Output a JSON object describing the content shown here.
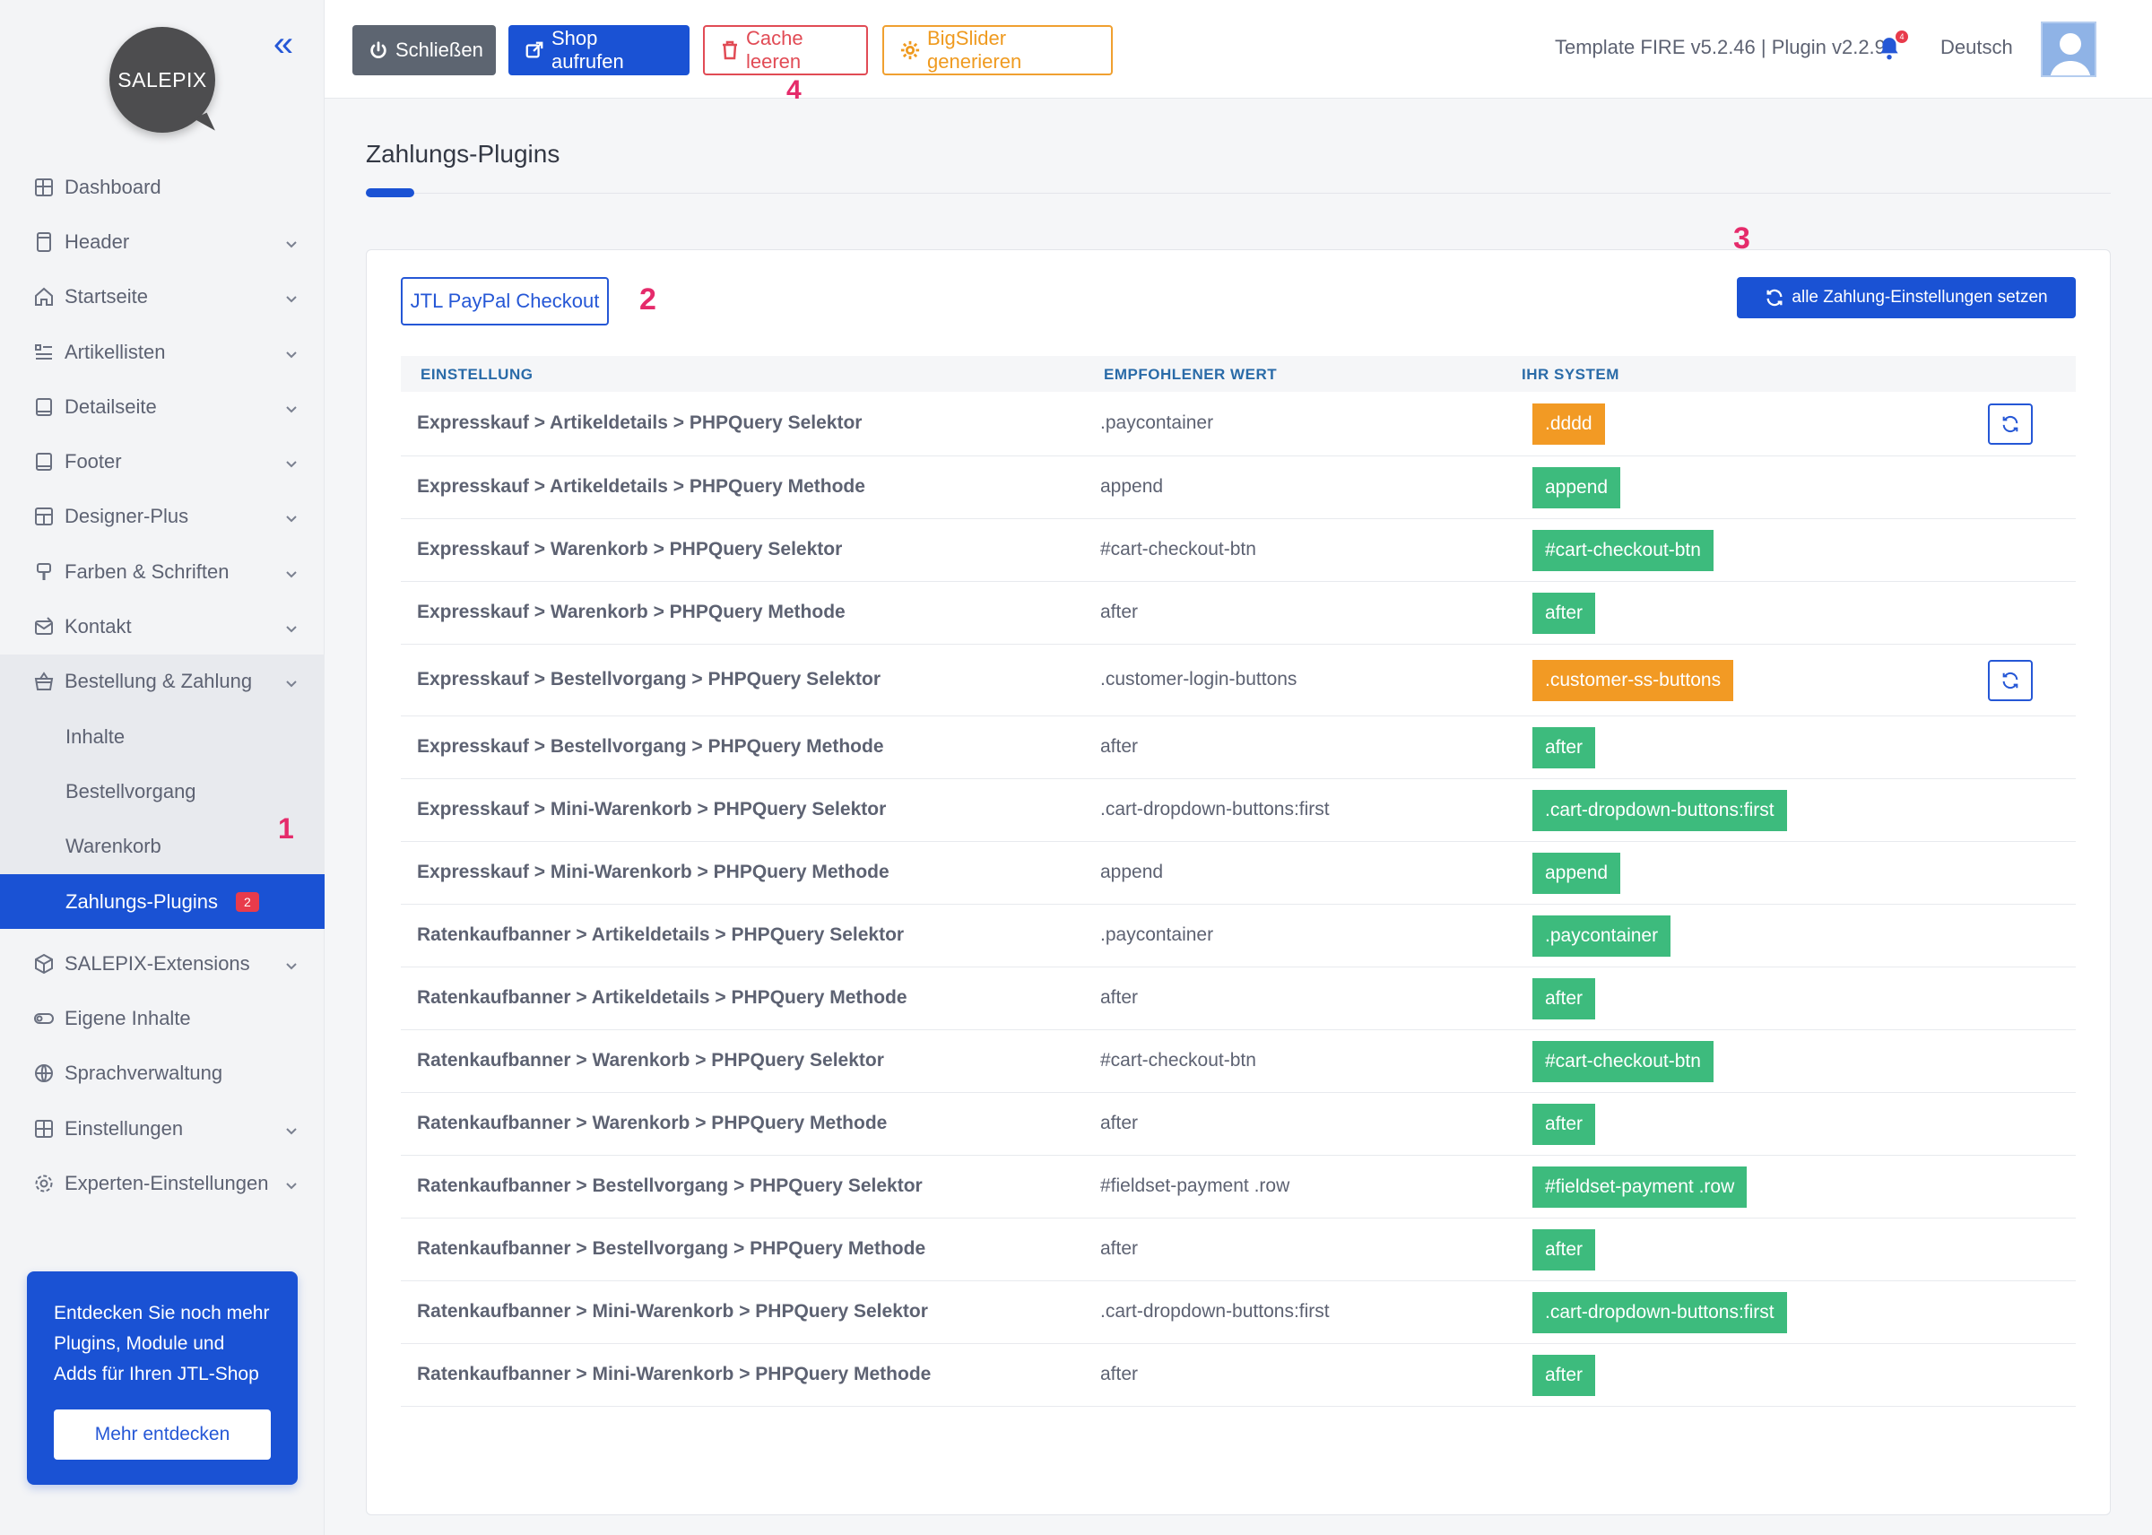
{
  "sidebar": {
    "logo_text": "SALEPIX",
    "nav": [
      {
        "label": "Dashboard",
        "icon": "dashboard-icon",
        "chevron": false
      },
      {
        "label": "Header",
        "icon": "header-icon",
        "chevron": true
      },
      {
        "label": "Startseite",
        "icon": "home-icon",
        "chevron": true
      },
      {
        "label": "Artikellisten",
        "icon": "list-icon",
        "chevron": true
      },
      {
        "label": "Detailseite",
        "icon": "detail-icon",
        "chevron": true
      },
      {
        "label": "Footer",
        "icon": "footer-icon",
        "chevron": true
      },
      {
        "label": "Designer-Plus",
        "icon": "layout-icon",
        "chevron": true
      },
      {
        "label": "Farben & Schriften",
        "icon": "brush-icon",
        "chevron": true
      },
      {
        "label": "Kontakt",
        "icon": "mail-icon",
        "chevron": true
      }
    ],
    "group": {
      "label": "Bestellung & Zahlung",
      "icon": "basket-icon",
      "items": [
        "Inhalte",
        "Bestellvorgang",
        "Warenkorb",
        "Zahlungs-Plugins"
      ],
      "active_badge": "2"
    },
    "nav_after": [
      {
        "label": "SALEPIX-Extensions",
        "icon": "box-icon",
        "chevron": true
      },
      {
        "label": "Eigene Inhalte",
        "icon": "toggle-icon",
        "chevron": false
      },
      {
        "label": "Sprachverwaltung",
        "icon": "globe-icon",
        "chevron": false
      },
      {
        "label": "Einstellungen",
        "icon": "grid-icon",
        "chevron": true
      },
      {
        "label": "Experten-Einstellungen",
        "icon": "gear-icon",
        "chevron": true
      }
    ],
    "promo": {
      "text": "Entdecken Sie noch mehr Plugins, Module und Adds für Ihren JTL-Shop",
      "button": "Mehr entdecken"
    }
  },
  "topbar": {
    "close_label": "Schließen",
    "shop_label": "Shop aufrufen",
    "cache_label": "Cache leeren",
    "slider_label": "BigSlider generieren",
    "version": "Template FIRE v5.2.46 | Plugin v2.2.9",
    "notification_count": "4",
    "language": "Deutsch"
  },
  "annotations": {
    "a1": "1",
    "a2": "2",
    "a3": "3",
    "a4": "4"
  },
  "main": {
    "title": "Zahlungs-Plugins",
    "tab_label": "JTL PayPal Checkout",
    "set_all_label": "alle Zahlung-Einstellungen setzen",
    "columns": {
      "setting": "EINSTELLUNG",
      "recommended": "EMPFOHLENER WERT",
      "system": "IHR SYSTEM"
    },
    "colors": {
      "ok": "#3dbb7d",
      "warn": "#f29a24",
      "accent": "#1a52d4"
    },
    "rows": [
      {
        "setting": "Expresskauf > Artikeldetails > PHPQuery Selektor",
        "recommended": ".paycontainer",
        "system": ".dddd",
        "status": "warn"
      },
      {
        "setting": "Expresskauf > Artikeldetails > PHPQuery Methode",
        "recommended": "append",
        "system": "append",
        "status": "ok"
      },
      {
        "setting": "Expresskauf > Warenkorb > PHPQuery Selektor",
        "recommended": "#cart-checkout-btn",
        "system": "#cart-checkout-btn",
        "status": "ok"
      },
      {
        "setting": "Expresskauf > Warenkorb > PHPQuery Methode",
        "recommended": "after",
        "system": "after",
        "status": "ok"
      },
      {
        "setting": "Expresskauf > Bestellvorgang > PHPQuery Selektor",
        "recommended": ".customer-login-buttons",
        "system": ".customer-ss-buttons",
        "status": "warn"
      },
      {
        "setting": "Expresskauf > Bestellvorgang > PHPQuery Methode",
        "recommended": "after",
        "system": "after",
        "status": "ok"
      },
      {
        "setting": "Expresskauf > Mini-Warenkorb > PHPQuery Selektor",
        "recommended": ".cart-dropdown-buttons:first",
        "system": ".cart-dropdown-buttons:first",
        "status": "ok"
      },
      {
        "setting": "Expresskauf > Mini-Warenkorb > PHPQuery Methode",
        "recommended": "append",
        "system": "append",
        "status": "ok"
      },
      {
        "setting": "Ratenkaufbanner > Artikeldetails > PHPQuery Selektor",
        "recommended": ".paycontainer",
        "system": ".paycontainer",
        "status": "ok"
      },
      {
        "setting": "Ratenkaufbanner > Artikeldetails > PHPQuery Methode",
        "recommended": "after",
        "system": "after",
        "status": "ok"
      },
      {
        "setting": "Ratenkaufbanner > Warenkorb > PHPQuery Selektor",
        "recommended": "#cart-checkout-btn",
        "system": "#cart-checkout-btn",
        "status": "ok"
      },
      {
        "setting": "Ratenkaufbanner > Warenkorb > PHPQuery Methode",
        "recommended": "after",
        "system": "after",
        "status": "ok"
      },
      {
        "setting": "Ratenkaufbanner > Bestellvorgang > PHPQuery Selektor",
        "recommended": "#fieldset-payment .row",
        "system": "#fieldset-payment .row",
        "status": "ok"
      },
      {
        "setting": "Ratenkaufbanner > Bestellvorgang > PHPQuery Methode",
        "recommended": "after",
        "system": "after",
        "status": "ok"
      },
      {
        "setting": "Ratenkaufbanner > Mini-Warenkorb > PHPQuery Selektor",
        "recommended": ".cart-dropdown-buttons:first",
        "system": ".cart-dropdown-buttons:first",
        "status": "ok"
      },
      {
        "setting": "Ratenkaufbanner > Mini-Warenkorb > PHPQuery Methode",
        "recommended": "after",
        "system": "after",
        "status": "ok"
      }
    ]
  }
}
